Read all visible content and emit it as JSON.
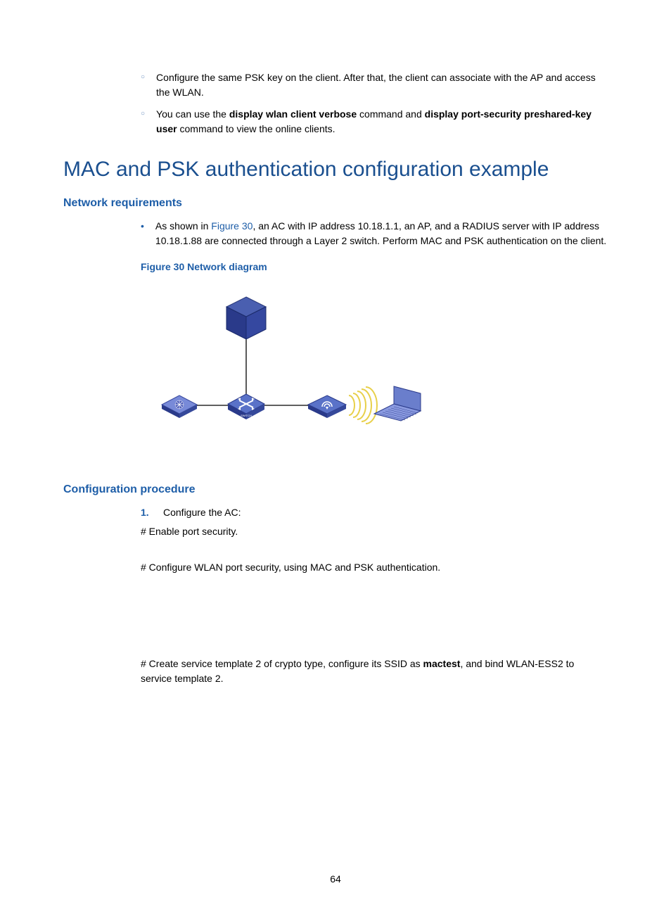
{
  "intro_bullets": [
    {
      "text": "Configure the same PSK key on the client. After that, the client can associate with the AP and access the WLAN."
    },
    {
      "prefix": "You can use the ",
      "b1": "display wlan client verbose",
      "mid": " command and ",
      "b2": "display port-security preshared-key user",
      "suffix": " command to view the online clients."
    }
  ],
  "h1": "MAC and PSK authentication configuration example",
  "net_req_heading": "Network requirements",
  "net_req_bullet": {
    "prefix": "As shown in ",
    "link": "Figure 30",
    "suffix": ", an AC with IP address 10.18.1.1, an AP, and a RADIUS server with IP address 10.18.1.88 are connected through a Layer 2 switch. Perform MAC and PSK authentication on the client."
  },
  "figure_title": "Figure 30 Network diagram",
  "config_heading": "Configuration procedure",
  "step1_label": "1.",
  "step1_text": "Configure the AC:",
  "step1_sub1": "# Enable port security.",
  "step1_sub2": "# Configure WLAN port security, using MAC and PSK authentication.",
  "step1_sub3_prefix": "# Create service template 2 of crypto type, configure its SSID as ",
  "step1_sub3_bold": "mactest",
  "step1_sub3_suffix": ", and bind WLAN-ESS2 to service template 2.",
  "page_number": "64"
}
